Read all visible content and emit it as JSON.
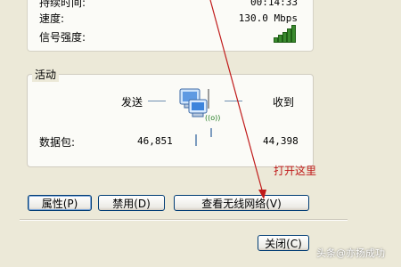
{
  "connection": {
    "duration_label": "持续时间:",
    "duration_value": "00:14:33",
    "speed_label": "速度:",
    "speed_value": "130.0 Mbps",
    "signal_label": "信号强度:",
    "signal_icon": "signal-strength-icon",
    "signal_bars_lit": 5
  },
  "activity": {
    "title": "活动",
    "sent_label": "发送",
    "received_label": "收到",
    "packets_label": "数据包:",
    "packets_sent": "46,851",
    "packets_received": "44,398",
    "network_icon": "network-computers-icon",
    "wireless_badge": "((o))"
  },
  "buttons": {
    "properties": "属性(P)",
    "disable": "禁用(D)",
    "view_wireless": "查看无线网络(V)",
    "close": "关闭(C)"
  },
  "annotation": {
    "text": "打开这里",
    "color": "#c01a1a"
  },
  "watermark": "头条@亦扬成功"
}
